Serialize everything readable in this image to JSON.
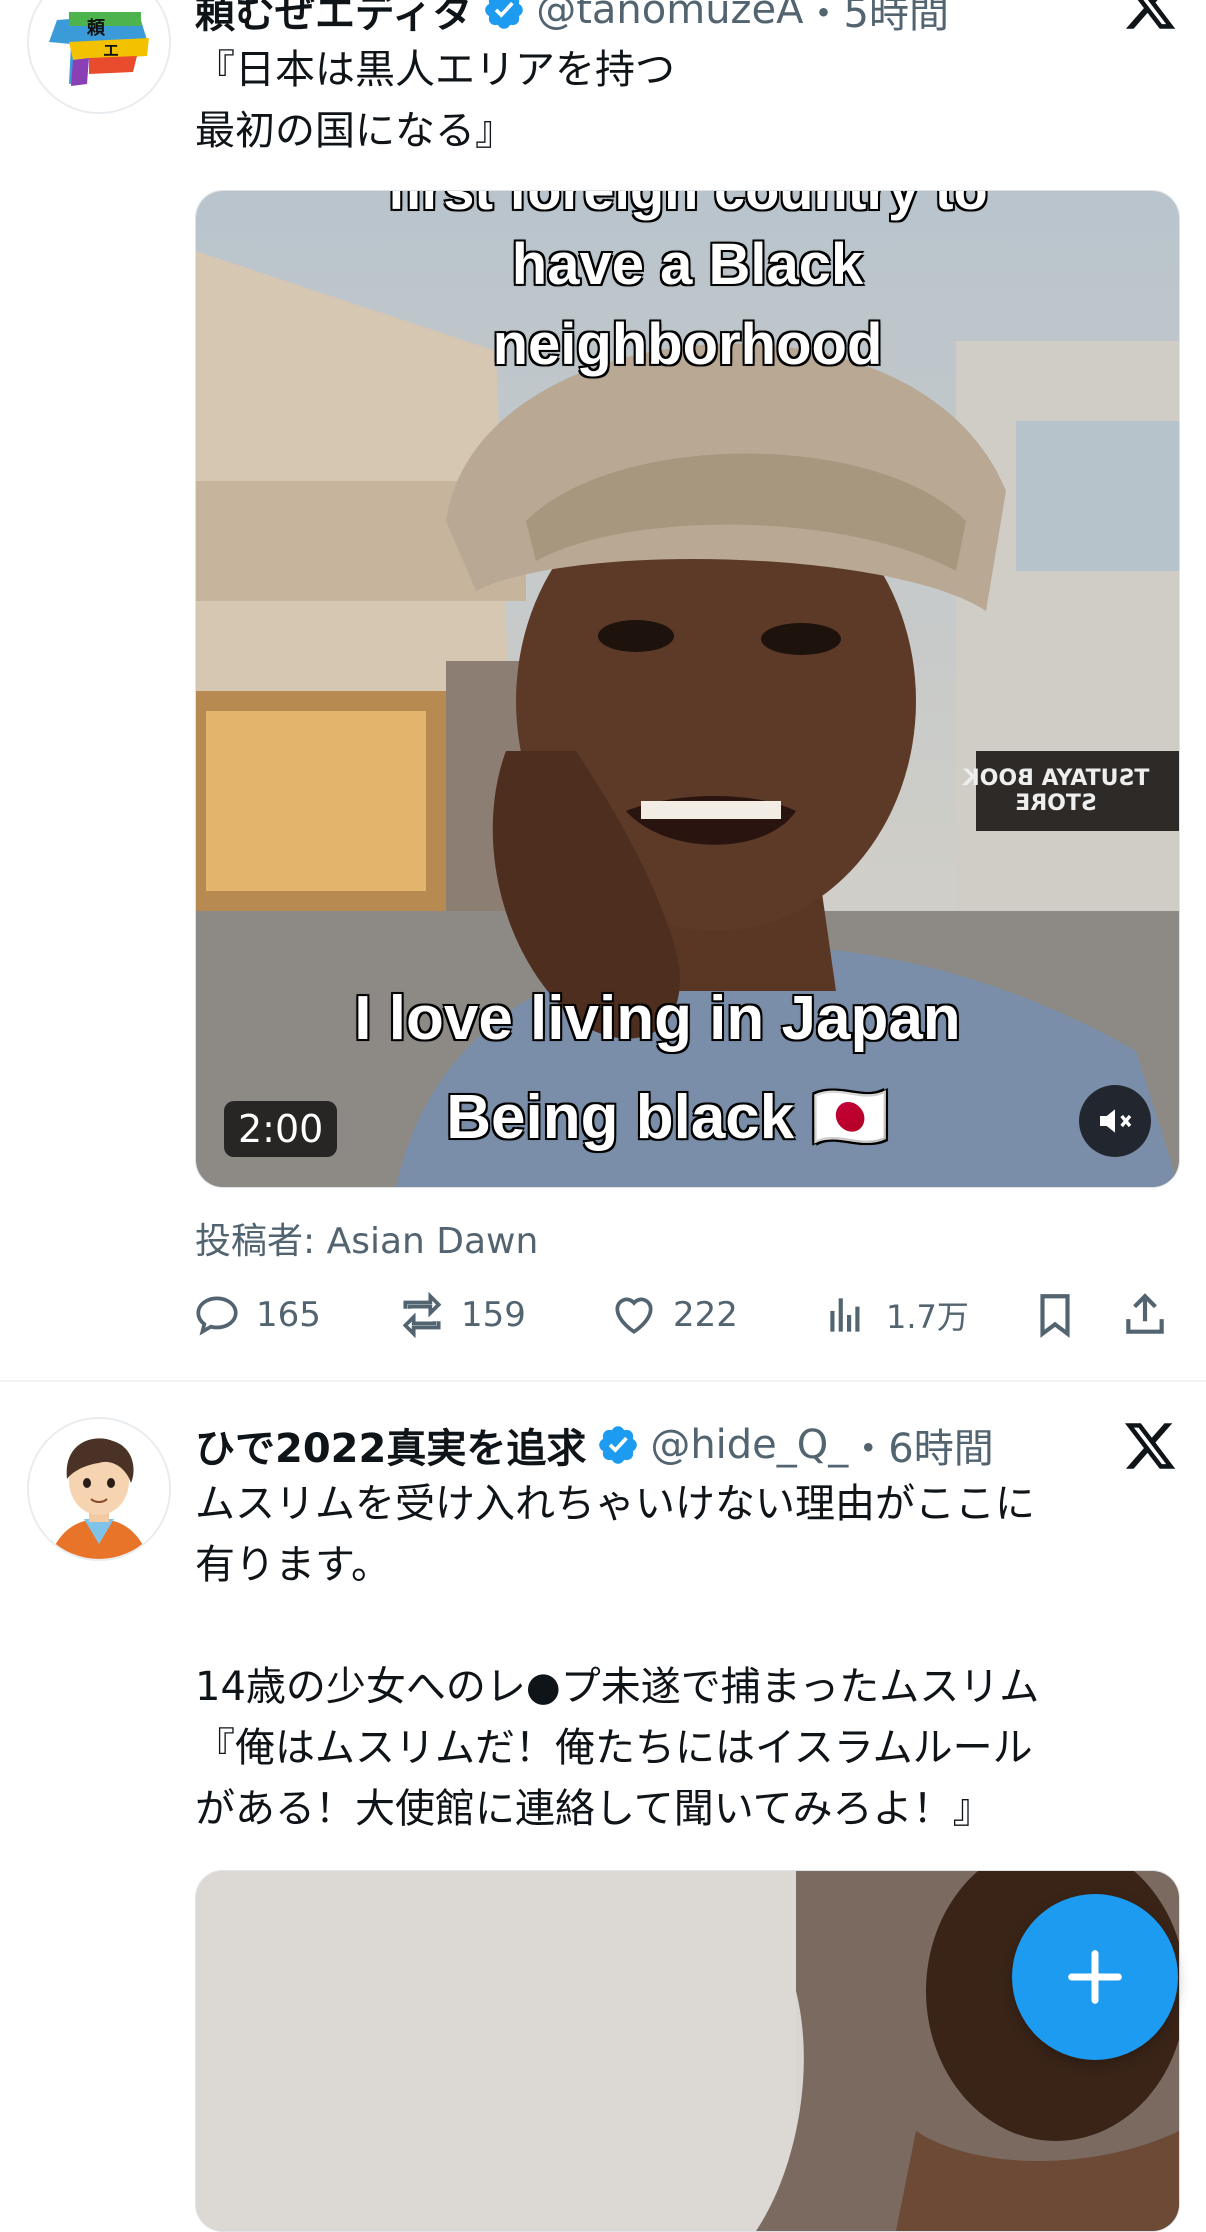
{
  "tweet1": {
    "name": "頼むぜエディタ",
    "handle": "@tanomuzeA",
    "time": "・5時間",
    "text": "『日本は黒人エリアを持つ\n最初の国になる』",
    "video": {
      "caption_top_1": "first foreign country to",
      "caption_top_2": "have a Black",
      "caption_top_3": "neighborhood",
      "caption_bottom_1": "I love living in Japan",
      "caption_bottom_2": "Being black 🇯🇵",
      "store_sign": "TSUTAYA BOOK STORE",
      "duration": "2:00"
    },
    "posted_by": "投稿者: Asian Dawn",
    "stats": {
      "replies": "165",
      "retweets": "159",
      "likes": "222",
      "views": "1.7万"
    }
  },
  "tweet2": {
    "name": "ひで2022真実を追求",
    "handle": "@hide_Q_",
    "time": "・6時間",
    "text": "ムスリムを受け入れちゃいけない理由がここに\n有ります。\n\n14歳の少女へのレ●プ未遂で捕まったムスリム\n『俺はムスリムだ！俺たちにはイスラムルール\nがある！大使館に連絡して聞いてみろよ！』"
  },
  "colors": {
    "accent": "#1d9bf0",
    "secondary_text": "#536471"
  },
  "icons": [
    "verified-badge-icon",
    "x-logo-icon",
    "reply-icon",
    "retweet-icon",
    "like-icon",
    "views-icon",
    "bookmark-icon",
    "share-icon",
    "mute-icon",
    "compose-plus-icon"
  ]
}
